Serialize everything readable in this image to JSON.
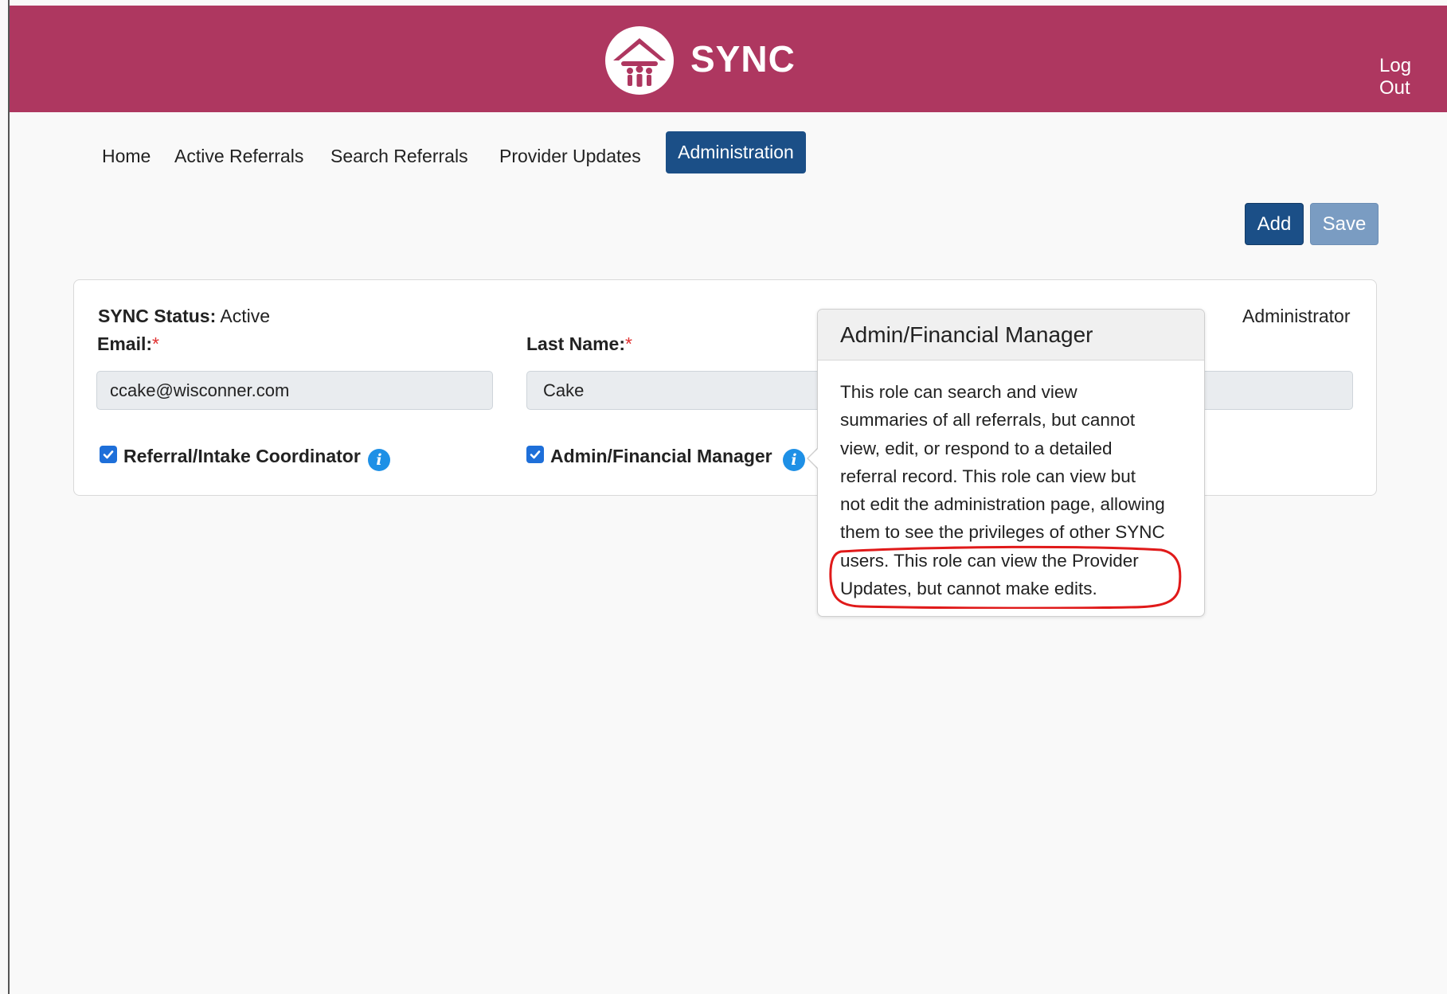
{
  "header": {
    "brand": "SYNC",
    "logout_label": "Log Out",
    "color": "#ae3760"
  },
  "nav": {
    "items": [
      "Home",
      "Active Referrals",
      "Search Referrals",
      "Provider Updates"
    ],
    "active": "Administration"
  },
  "toolbar": {
    "add_label": "Add",
    "save_label": "Save"
  },
  "user_card": {
    "status_label": "SYNC Status:",
    "status_value": "Active",
    "role_label": "Administrator",
    "email_label": "Email:",
    "email_value": "ccake@wisconner.com",
    "last_name_label": "Last Name:",
    "last_name_value": "Cake",
    "required_marker": "*",
    "roles": [
      {
        "label": "Referral/Intake Coordinator",
        "checked": true
      },
      {
        "label": "Admin/Financial Manager",
        "checked": true
      }
    ]
  },
  "popover": {
    "title": "Admin/Financial Manager",
    "lines": [
      "This role can search and view",
      "summaries of all referrals, but cannot",
      "view, edit, or respond to a detailed",
      "referral record. This role can view but",
      "not edit the administration page, allowing",
      "them to see the privileges of other SYNC",
      "users. This role can view the Provider",
      "Updates, but cannot make edits."
    ]
  },
  "icons": {
    "logo": "house-people-icon",
    "info": "info-icon",
    "check": "checkmark-icon"
  },
  "colors": {
    "nav_active": "#1b4f87",
    "save_disabled": "#7a9cc2",
    "highlight": "#e01a1a"
  }
}
